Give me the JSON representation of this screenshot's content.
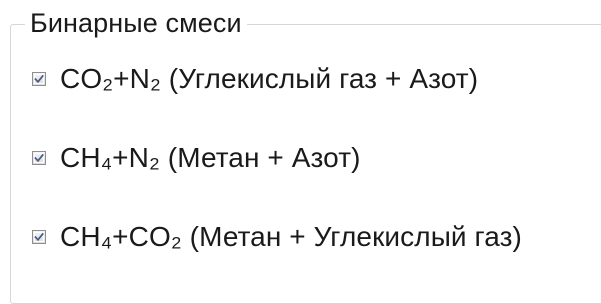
{
  "group": {
    "title": "Бинарные смеси"
  },
  "options": [
    {
      "label": "CO₂+N₂ (Углекислый газ + Азот)",
      "checked": true
    },
    {
      "label": "CH₄+N₂ (Метан + Азот)",
      "checked": true
    },
    {
      "label": "CH₄+CO₂ (Метан + Углекислый газ)",
      "checked": true
    }
  ],
  "colors": {
    "checkmark": "#4a5d8a",
    "checkbox_border": "#8e8f8f",
    "groupbox_border": "#d6d6d6"
  },
  "icons": {
    "checkmark": "check-icon"
  }
}
